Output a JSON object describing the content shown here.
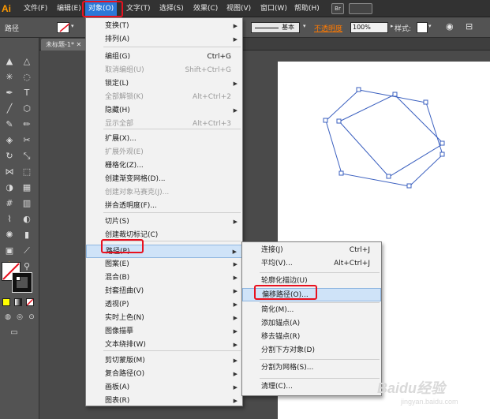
{
  "app": {
    "logo": "Ai"
  },
  "menubar": {
    "items": [
      "文件(F)",
      "编辑(E)",
      "对象(O)",
      "文字(T)",
      "选择(S)",
      "效果(C)",
      "视图(V)",
      "窗口(W)",
      "帮助(H)"
    ],
    "icon_label": "Br"
  },
  "controlbar": {
    "label": "路径",
    "stroke_style": "基本",
    "opacity_label": "不透明度",
    "opacity_value": "100%",
    "style_label": "样式:"
  },
  "document_tab": {
    "title": "未标题-1*"
  },
  "object_menu": {
    "items": [
      {
        "label": "变换(T)",
        "shortcut": "",
        "submenu": true,
        "disabled": false
      },
      {
        "label": "排列(A)",
        "shortcut": "",
        "submenu": true,
        "disabled": false
      },
      {
        "label": "编组(G)",
        "shortcut": "Ctrl+G",
        "submenu": false,
        "disabled": false
      },
      {
        "label": "取消编组(U)",
        "shortcut": "Shift+Ctrl+G",
        "submenu": false,
        "disabled": true
      },
      {
        "label": "锁定(L)",
        "shortcut": "",
        "submenu": true,
        "disabled": false
      },
      {
        "label": "全部解锁(K)",
        "shortcut": "Alt+Ctrl+2",
        "submenu": false,
        "disabled": true
      },
      {
        "label": "隐藏(H)",
        "shortcut": "",
        "submenu": true,
        "disabled": false
      },
      {
        "label": "显示全部",
        "shortcut": "Alt+Ctrl+3",
        "submenu": false,
        "disabled": true
      },
      {
        "label": "扩展(X)...",
        "shortcut": "",
        "submenu": false,
        "disabled": false
      },
      {
        "label": "扩展外观(E)",
        "shortcut": "",
        "submenu": false,
        "disabled": true
      },
      {
        "label": "栅格化(Z)...",
        "shortcut": "",
        "submenu": false,
        "disabled": false
      },
      {
        "label": "创建渐变网格(D)...",
        "shortcut": "",
        "submenu": false,
        "disabled": false
      },
      {
        "label": "创建对象马赛克(J)...",
        "shortcut": "",
        "submenu": false,
        "disabled": true
      },
      {
        "label": "拼合透明度(F)...",
        "shortcut": "",
        "submenu": false,
        "disabled": false
      },
      {
        "label": "切片(S)",
        "shortcut": "",
        "submenu": true,
        "disabled": false
      },
      {
        "label": "创建裁切标记(C)",
        "shortcut": "",
        "submenu": false,
        "disabled": false
      },
      {
        "label": "路径(P)",
        "shortcut": "",
        "submenu": true,
        "disabled": false
      },
      {
        "label": "图案(E)",
        "shortcut": "",
        "submenu": true,
        "disabled": false
      },
      {
        "label": "混合(B)",
        "shortcut": "",
        "submenu": true,
        "disabled": false
      },
      {
        "label": "封套扭曲(V)",
        "shortcut": "",
        "submenu": true,
        "disabled": false
      },
      {
        "label": "透视(P)",
        "shortcut": "",
        "submenu": true,
        "disabled": false
      },
      {
        "label": "实时上色(N)",
        "shortcut": "",
        "submenu": true,
        "disabled": false
      },
      {
        "label": "图像描摹",
        "shortcut": "",
        "submenu": true,
        "disabled": false
      },
      {
        "label": "文本绕排(W)",
        "shortcut": "",
        "submenu": true,
        "disabled": false
      },
      {
        "label": "剪切蒙版(M)",
        "shortcut": "",
        "submenu": true,
        "disabled": false
      },
      {
        "label": "复合路径(O)",
        "shortcut": "",
        "submenu": true,
        "disabled": false
      },
      {
        "label": "画板(A)",
        "shortcut": "",
        "submenu": true,
        "disabled": false
      },
      {
        "label": "图表(R)",
        "shortcut": "",
        "submenu": true,
        "disabled": false
      }
    ]
  },
  "path_submenu": {
    "items": [
      {
        "label": "连接(J)",
        "shortcut": "Ctrl+J"
      },
      {
        "label": "平均(V)...",
        "shortcut": "Alt+Ctrl+J"
      },
      {
        "label": "轮廓化描边(U)",
        "shortcut": ""
      },
      {
        "label": "偏移路径(O)...",
        "shortcut": ""
      },
      {
        "label": "简化(M)...",
        "shortcut": ""
      },
      {
        "label": "添加锚点(A)",
        "shortcut": ""
      },
      {
        "label": "移去锚点(R)",
        "shortcut": ""
      },
      {
        "label": "分割下方对象(D)",
        "shortcut": ""
      },
      {
        "label": "分割为网格(S)...",
        "shortcut": ""
      },
      {
        "label": "清理(C)...",
        "shortcut": ""
      }
    ]
  },
  "colors": {
    "accent": "#2b78d8",
    "highlight_box": "#e8111f",
    "path": "#3a5fbf",
    "opacity_label": "#ff7a00"
  },
  "watermark": {
    "logo": "Baidu经验",
    "domain": "jingyan.baidu.com"
  }
}
